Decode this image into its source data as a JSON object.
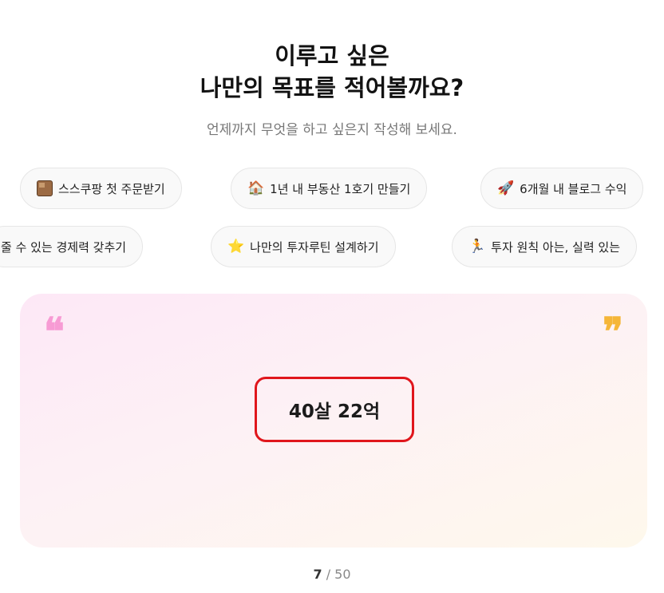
{
  "header": {
    "title_line1": "이루고 싶은",
    "title_line2": "나만의 목표를 적어볼까요?",
    "subtitle": "언제까지 무엇을 하고 싶은지 작성해 보세요."
  },
  "chips_row1": [
    {
      "icon": "box-icon",
      "glyph": "",
      "label": "스스쿠팡 첫 주문받기"
    },
    {
      "icon": "house-icon",
      "glyph": "🏠",
      "label": "1년 내 부동산 1호기 만들기"
    },
    {
      "icon": "rocket-icon",
      "glyph": "🚀",
      "label": "6개월 내 블로그 수익"
    }
  ],
  "chips_row2": [
    {
      "icon": "",
      "glyph": "",
      "label": "줄 수 있는 경제력 갖추기"
    },
    {
      "icon": "star-icon",
      "glyph": "⭐",
      "label": "나만의 투자루틴 설계하기"
    },
    {
      "icon": "runner-icon",
      "glyph": "🏃",
      "label": "투자 원칙 아는, 실력 있는"
    }
  ],
  "goal_card": {
    "open_quote": "❝",
    "close_quote": "❞",
    "goal_text": "40살 22억"
  },
  "counter": {
    "current": "7",
    "separator": " / ",
    "max": "50"
  },
  "colors": {
    "open_quote": "#f79bd4",
    "close_quote": "#f5b638",
    "highlight_border": "#e0161c"
  }
}
